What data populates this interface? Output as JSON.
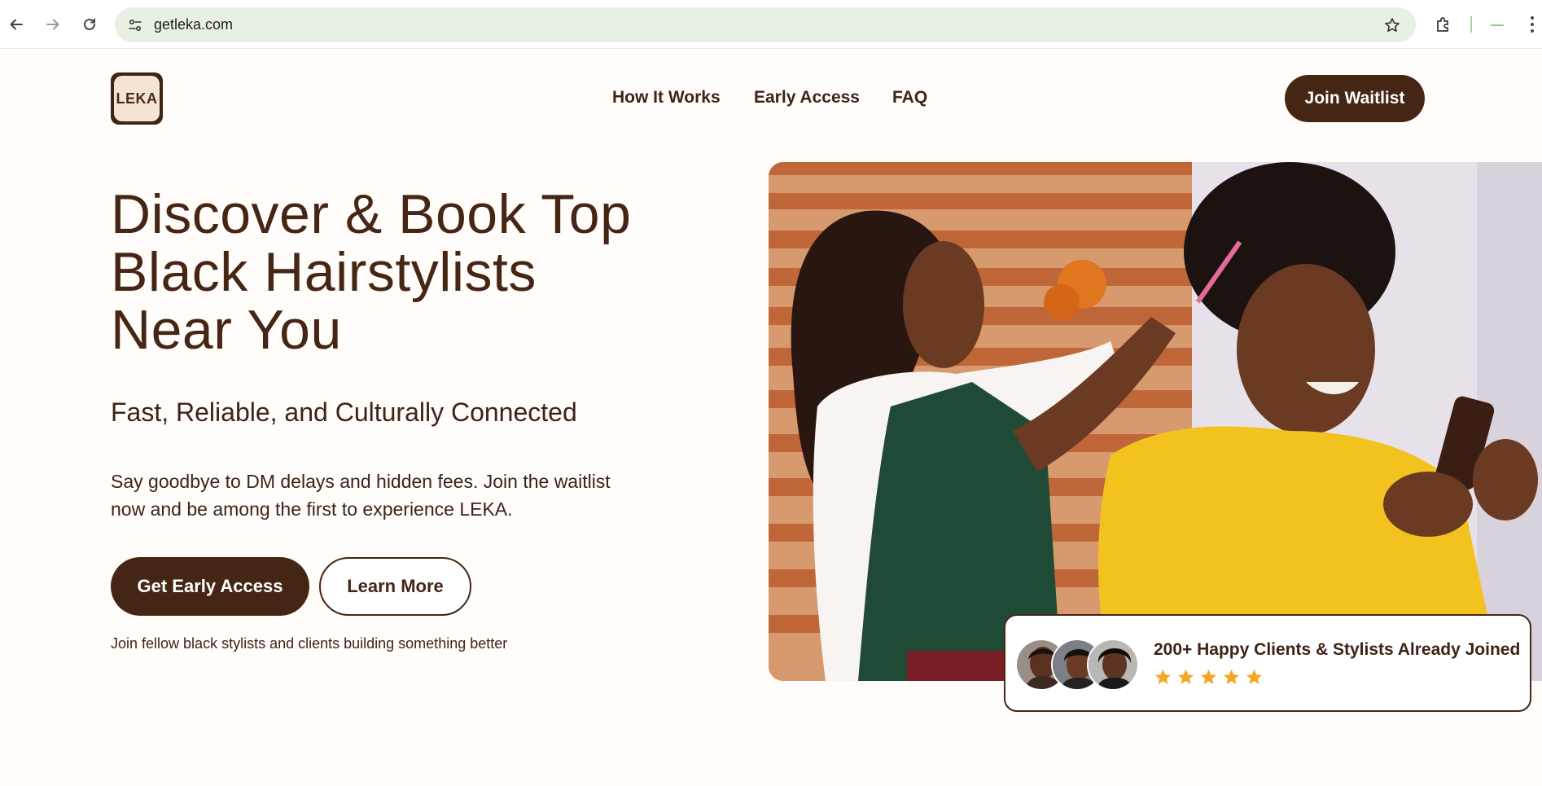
{
  "browser": {
    "url": "getleka.com",
    "icons": [
      "back-arrow-icon",
      "forward-arrow-icon",
      "reload-icon",
      "site-info-icon",
      "bookmark-star-icon",
      "extensions-icon",
      "profile-icon",
      "more-menu-icon"
    ]
  },
  "header": {
    "logo_text": "LEKA",
    "nav": [
      "How It Works",
      "Early Access",
      "FAQ"
    ],
    "cta_label": "Join Waitlist"
  },
  "hero": {
    "title_lines": [
      "Discover & Book Top",
      "Black Hairstylists",
      "Near You"
    ],
    "subtitle": "Fast, Reliable, and Culturally Connected",
    "description": "Say goodbye to DM delays and hidden fees. Join the waitlist now and be among the first to experience LEKA.",
    "primary_button": "Get Early Access",
    "secondary_button": "Learn More",
    "note": "Join fellow black stylists and clients building something better"
  },
  "social_proof": {
    "text": "200+ Happy Clients & Stylists Already Joined",
    "rating": 5,
    "star_color": "#f5a623"
  },
  "colors": {
    "brand_brown": "#452615",
    "text_brown": "#3d2416",
    "omnibox_bg": "#e8f0e4"
  }
}
